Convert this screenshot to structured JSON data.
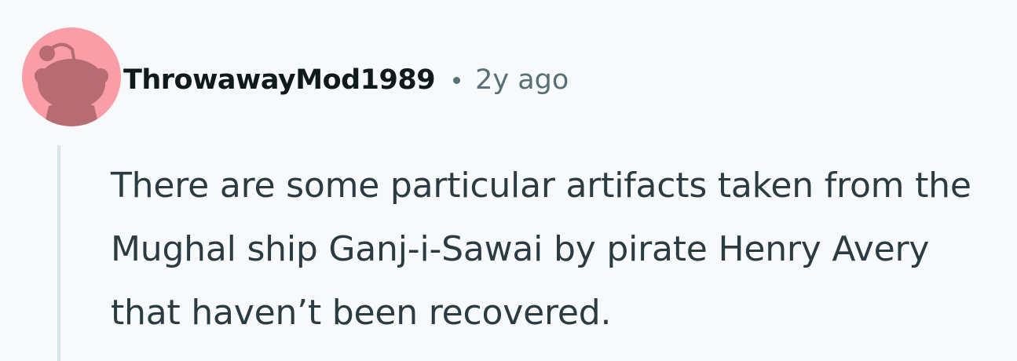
{
  "comment": {
    "author": "ThrowawayMod1989",
    "separator": "•",
    "timestamp": "2y ago",
    "body": "There are some particular artifacts taken from the Mughal ship Ganj-i-Sawai by pirate Henry Avery that haven’t been recovered.",
    "avatar": {
      "icon": "reddit-snoo-avatar-icon",
      "background_color": "#f99ea6",
      "figure_color": "#b76b73"
    }
  },
  "colors": {
    "page_background": "#f7f9fa",
    "author_text": "#0f1a1c",
    "meta_text": "#576f76",
    "body_text": "#2a3c42",
    "thread_line": "#d9e3ea"
  }
}
